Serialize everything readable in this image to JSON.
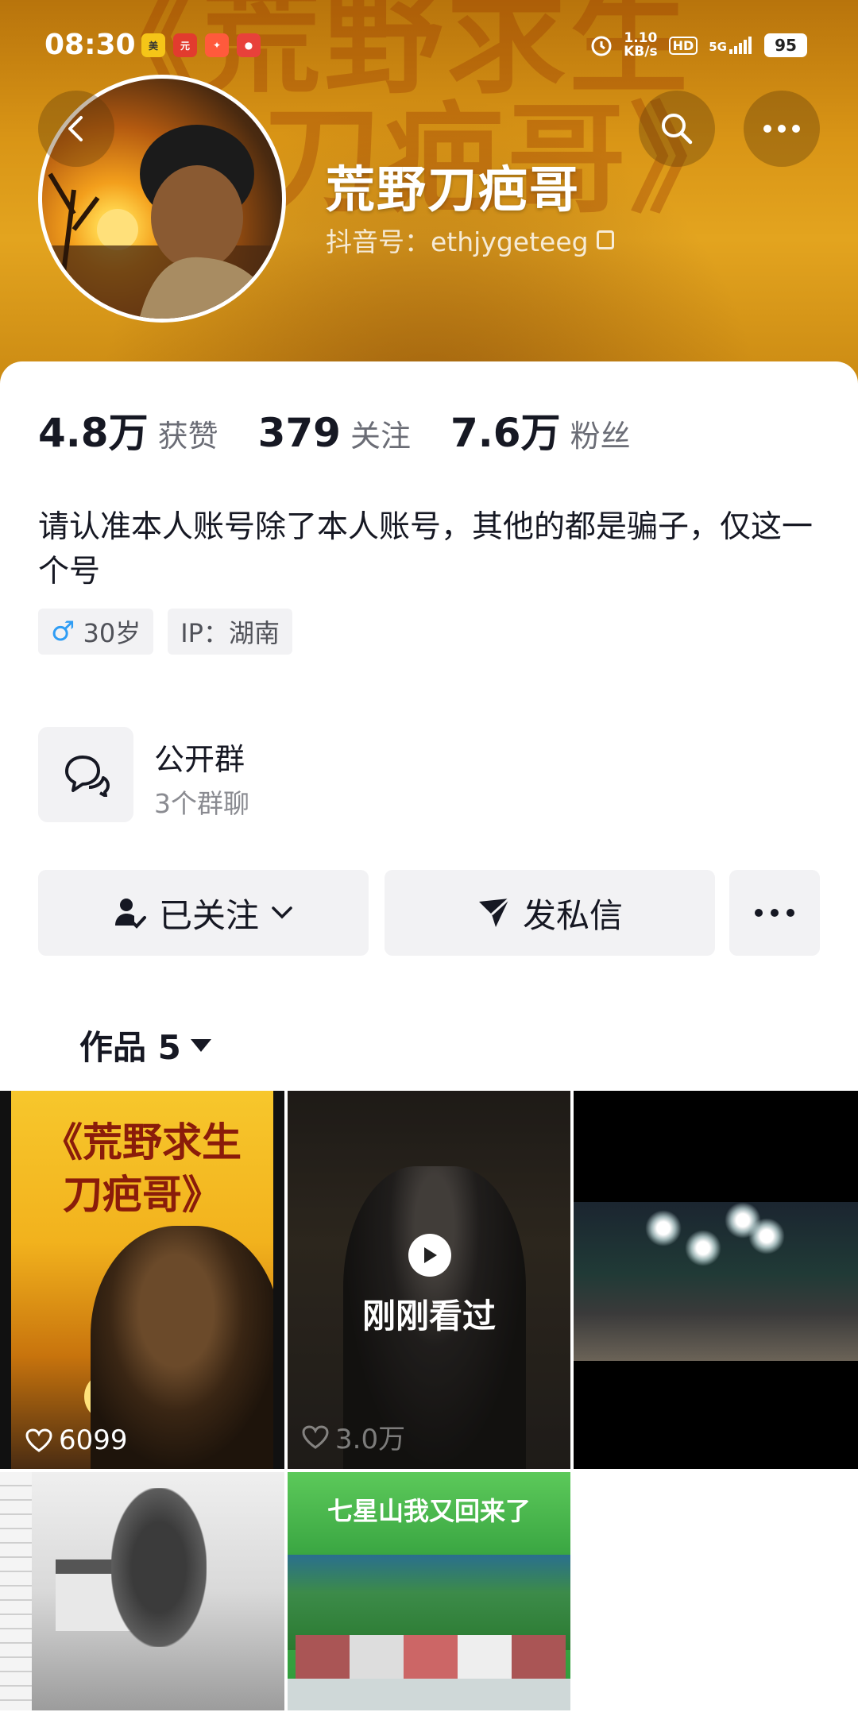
{
  "status_bar": {
    "time": "08:30",
    "net_speed_value": "1.10",
    "net_speed_unit": "KB/s",
    "hd": "HD",
    "network": "5G",
    "battery": "95"
  },
  "header": {
    "name": "荒野刀疤哥",
    "douyin_id": "抖音号：ethjygeteeg",
    "banner_bg_text_1": "《荒野求生",
    "banner_bg_text_2": "刀疤哥》"
  },
  "stats": [
    {
      "value": "4.8万",
      "label": "获赞"
    },
    {
      "value": "379",
      "label": "关注"
    },
    {
      "value": "7.6万",
      "label": "粉丝"
    }
  ],
  "bio": "请认准本人账号除了本人账号，其他的都是骗子，仅这一个号",
  "tags": {
    "age": "30岁",
    "ip": "IP：湖南"
  },
  "group": {
    "title": "公开群",
    "subtitle": "3个群聊"
  },
  "actions": {
    "follow": "已关注",
    "message": "发私信"
  },
  "works_tab": {
    "label": "作品 5"
  },
  "videos": [
    {
      "title_line1": "《荒野求生",
      "title_line2": "刀疤哥》",
      "likes": "6099"
    },
    {
      "overlay": "刚刚看过",
      "likes": "3.0万"
    },
    {},
    {},
    {
      "title": "七星山我又回来了"
    }
  ],
  "colors": {
    "banner": "#e3a41f",
    "male_icon": "#2f9df4",
    "button_bg": "#f2f2f4"
  }
}
